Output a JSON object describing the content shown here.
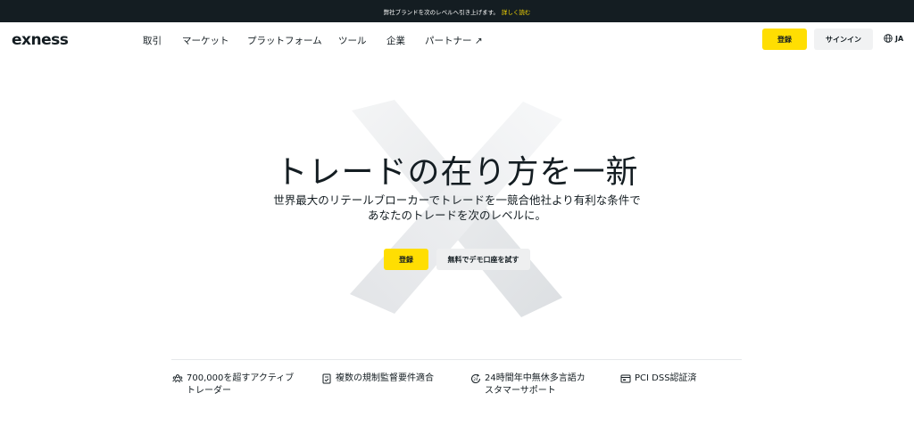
{
  "announcement": {
    "text": "弊社ブランドを次のレベルへ引き上げます。",
    "link": "詳しく読む"
  },
  "brand": {
    "logo": "exness"
  },
  "nav": {
    "items": [
      {
        "label": "取引"
      },
      {
        "label": "マーケット"
      },
      {
        "label": "プラットフォーム"
      },
      {
        "label": "ツール"
      },
      {
        "label": "企業"
      },
      {
        "label": "パートナー ↗"
      }
    ],
    "signup": "登録",
    "signin": "サインイン",
    "language": "JA"
  },
  "hero": {
    "title": "トレードの在り方を一新",
    "subtitle": "世界最大のリテールブローカーでトレードを一競合他社より有利な条件であなたのトレードを次のレベルに。",
    "cta_signup": "登録",
    "cta_demo": "無料でデモ口座を試す"
  },
  "features": [
    {
      "icon": "users-icon",
      "text": "700,000を超すアクティブ\nトレーダー"
    },
    {
      "icon": "document-check-icon",
      "text": "複数の規制監督要件適合"
    },
    {
      "icon": "support-24-icon",
      "text": "24時間年中無休多言語カ\nスタマーサポート"
    },
    {
      "icon": "shield-card-icon",
      "text": "PCI DSS認証済"
    }
  ],
  "colors": {
    "accent": "#ffde02",
    "dark": "#141d22",
    "button_grey": "#f1f2f3"
  }
}
